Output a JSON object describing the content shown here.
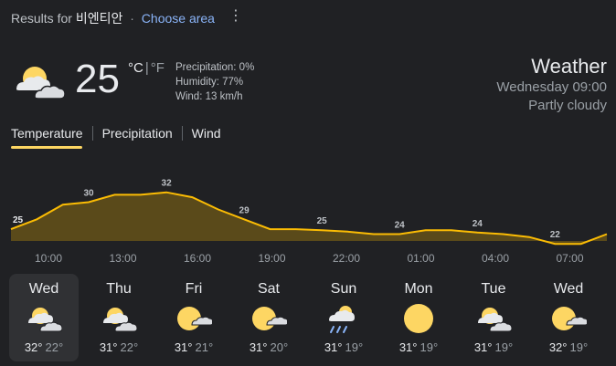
{
  "header": {
    "results_prefix": "Results for",
    "query": "비엔티안",
    "separator": "·",
    "choose_area": "Choose area",
    "menu_icon": "more-vert-icon"
  },
  "current": {
    "icon": "partly-cloudy-icon",
    "temperature": "25",
    "unit_c": "°C",
    "unit_divider": "|",
    "unit_f": "°F",
    "precipitation": "Precipitation: 0%",
    "humidity": "Humidity: 77%",
    "wind": "Wind: 13 km/h"
  },
  "title": {
    "heading": "Weather",
    "datetime": "Wednesday 09:00",
    "condition": "Partly cloudy"
  },
  "tabs": [
    {
      "label": "Temperature",
      "active": true
    },
    {
      "label": "Precipitation",
      "active": false
    },
    {
      "label": "Wind",
      "active": false
    }
  ],
  "chart_data": {
    "type": "area",
    "temperatures": [
      25,
      27,
      30,
      30.5,
      32,
      32,
      32.5,
      31.5,
      29,
      27,
      25,
      25,
      24.8,
      24.5,
      24,
      24,
      24.8,
      24.8,
      24.3,
      24,
      23.4,
      22,
      22,
      24
    ],
    "labels": [
      {
        "index": 0,
        "text": "25"
      },
      {
        "index": 3,
        "text": "30"
      },
      {
        "index": 6,
        "text": "32"
      },
      {
        "index": 9,
        "text": "29"
      },
      {
        "index": 12,
        "text": "25"
      },
      {
        "index": 15,
        "text": "24"
      },
      {
        "index": 18,
        "text": "24"
      },
      {
        "index": 21,
        "text": "22"
      }
    ],
    "x_ticks": [
      "10:00",
      "13:00",
      "16:00",
      "19:00",
      "22:00",
      "01:00",
      "04:00",
      "07:00"
    ],
    "colors": {
      "line": "#fbbc04",
      "fill": "#5a4a1a",
      "label": "#bdc1c6"
    }
  },
  "forecast": [
    {
      "day": "Wed",
      "icon": "partly-cloudy-icon",
      "hi": "32°",
      "lo": "22°",
      "selected": true
    },
    {
      "day": "Thu",
      "icon": "partly-cloudy-icon",
      "hi": "31°",
      "lo": "22°",
      "selected": false
    },
    {
      "day": "Fri",
      "icon": "mostly-sunny-icon",
      "hi": "31°",
      "lo": "21°",
      "selected": false
    },
    {
      "day": "Sat",
      "icon": "mostly-sunny-icon",
      "hi": "31°",
      "lo": "20°",
      "selected": false
    },
    {
      "day": "Sun",
      "icon": "scattered-showers-icon",
      "hi": "31°",
      "lo": "19°",
      "selected": false
    },
    {
      "day": "Mon",
      "icon": "sunny-icon",
      "hi": "31°",
      "lo": "19°",
      "selected": false
    },
    {
      "day": "Tue",
      "icon": "partly-cloudy-icon",
      "hi": "31°",
      "lo": "19°",
      "selected": false
    },
    {
      "day": "Wed",
      "icon": "mostly-sunny-icon",
      "hi": "32°",
      "lo": "19°",
      "selected": false
    }
  ]
}
